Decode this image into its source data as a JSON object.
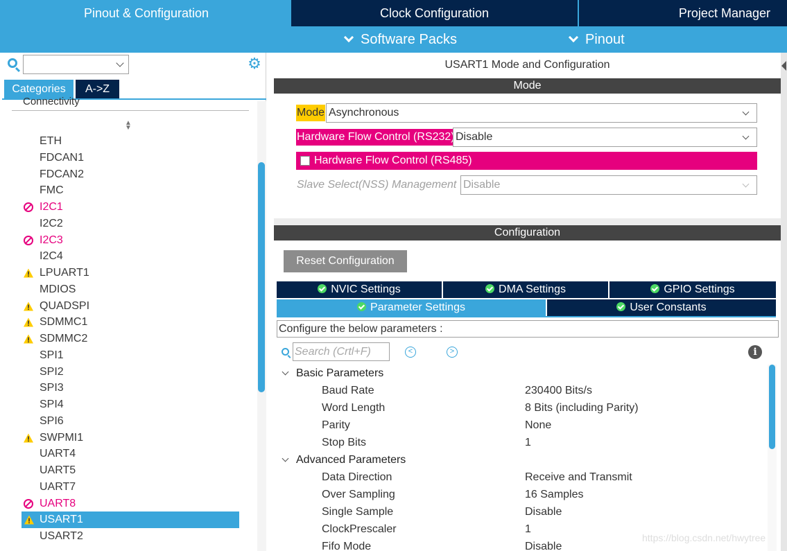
{
  "top_tabs": {
    "pinout_config": "Pinout & Configuration",
    "clock_config": "Clock Configuration",
    "project_manager": "Project Manager"
  },
  "sub_menus": {
    "software_packs": "Software Packs",
    "pinout": "Pinout"
  },
  "left": {
    "search_value": "",
    "tabs": {
      "categories": "Categories",
      "az": "A->Z"
    },
    "group_label": "Connectivity",
    "peripherals": [
      {
        "label": "ETH",
        "status": "none"
      },
      {
        "label": "FDCAN1",
        "status": "none"
      },
      {
        "label": "FDCAN2",
        "status": "none"
      },
      {
        "label": "FMC",
        "status": "none"
      },
      {
        "label": "I2C1",
        "status": "error"
      },
      {
        "label": "I2C2",
        "status": "none"
      },
      {
        "label": "I2C3",
        "status": "error"
      },
      {
        "label": "I2C4",
        "status": "none"
      },
      {
        "label": "LPUART1",
        "status": "warning"
      },
      {
        "label": "MDIOS",
        "status": "none"
      },
      {
        "label": "QUADSPI",
        "status": "warning"
      },
      {
        "label": "SDMMC1",
        "status": "warning"
      },
      {
        "label": "SDMMC2",
        "status": "warning"
      },
      {
        "label": "SPI1",
        "status": "none"
      },
      {
        "label": "SPI2",
        "status": "none"
      },
      {
        "label": "SPI3",
        "status": "none"
      },
      {
        "label": "SPI4",
        "status": "none"
      },
      {
        "label": "SPI6",
        "status": "none"
      },
      {
        "label": "SWPMI1",
        "status": "warning"
      },
      {
        "label": "UART4",
        "status": "none"
      },
      {
        "label": "UART5",
        "status": "none"
      },
      {
        "label": "UART7",
        "status": "none"
      },
      {
        "label": "UART8",
        "status": "error"
      },
      {
        "label": "USART1",
        "status": "warning",
        "selected": true
      },
      {
        "label": "USART2",
        "status": "none"
      }
    ]
  },
  "right": {
    "title": "USART1 Mode and Configuration",
    "mode_section": "Mode",
    "mode_label": "Mode",
    "mode_value": "Asynchronous",
    "hfc232_label": "Hardware Flow Control (RS232)",
    "hfc232_value": "Disable",
    "hfc485_label": "Hardware Flow Control (RS485)",
    "nss_label": "Slave Select(NSS) Management",
    "nss_value": "Disable",
    "config_section": "Configuration",
    "reset_button": "Reset Configuration",
    "config_tabs": {
      "nvic": "NVIC Settings",
      "dma": "DMA Settings",
      "gpio": "GPIO Settings",
      "params": "Parameter Settings",
      "user_constants": "User Constants"
    },
    "param_hint": "Configure the below parameters :",
    "search_placeholder": "Search (Crtl+F)",
    "groups": [
      {
        "name": "Basic Parameters",
        "rows": [
          {
            "name": "Baud Rate",
            "value": "230400 Bits/s"
          },
          {
            "name": "Word Length",
            "value": "8 Bits (including Parity)"
          },
          {
            "name": "Parity",
            "value": "None"
          },
          {
            "name": "Stop Bits",
            "value": "1"
          }
        ]
      },
      {
        "name": "Advanced Parameters",
        "rows": [
          {
            "name": "Data Direction",
            "value": "Receive and Transmit"
          },
          {
            "name": "Over Sampling",
            "value": "16 Samples"
          },
          {
            "name": "Single Sample",
            "value": "Disable"
          },
          {
            "name": "ClockPrescaler",
            "value": "1"
          },
          {
            "name": "Fifo Mode",
            "value": "Disable"
          }
        ]
      }
    ]
  },
  "watermark": "https://blog.csdn.net/hwytree",
  "colors": {
    "accent": "#3aa6db",
    "dark_tab": "#03234b",
    "error": "#e6007e",
    "warning": "#ffcc00",
    "ok": "#4cd964",
    "section_bar": "#444444"
  }
}
